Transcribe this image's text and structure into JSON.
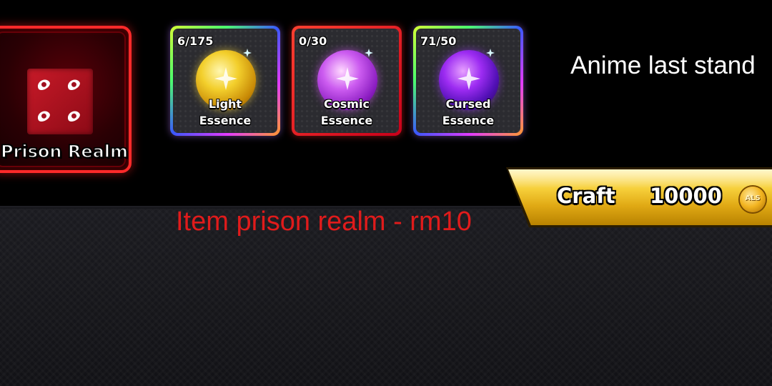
{
  "header": {
    "game_title": "Anime last stand"
  },
  "item": {
    "name": "Prison Realm",
    "icon": "cube-eyes-icon",
    "color": "#ff2a2a"
  },
  "essences": [
    {
      "name_line1": "Light",
      "name_line2": "Essence",
      "count": "6/175",
      "owned": 6,
      "required": 175,
      "border": "rainbow",
      "orb_color": "#f3cf2c"
    },
    {
      "name_line1": "Cosmic",
      "name_line2": "Essence",
      "count": "0/30",
      "owned": 0,
      "required": 30,
      "border": "red",
      "orb_color": "#cc5cf0"
    },
    {
      "name_line1": "Cursed",
      "name_line2": "Essence",
      "count": "71/50",
      "owned": 71,
      "required": 50,
      "border": "rainbow",
      "orb_color": "#9d2cf2"
    }
  ],
  "craft": {
    "label": "Craft",
    "price": "10000",
    "currency_icon": "als-coin-icon",
    "currency_text": "ALS",
    "color": "#f6cf3a"
  },
  "note": {
    "text": "Item prison realm - rm10",
    "color": "#e01b1b"
  }
}
